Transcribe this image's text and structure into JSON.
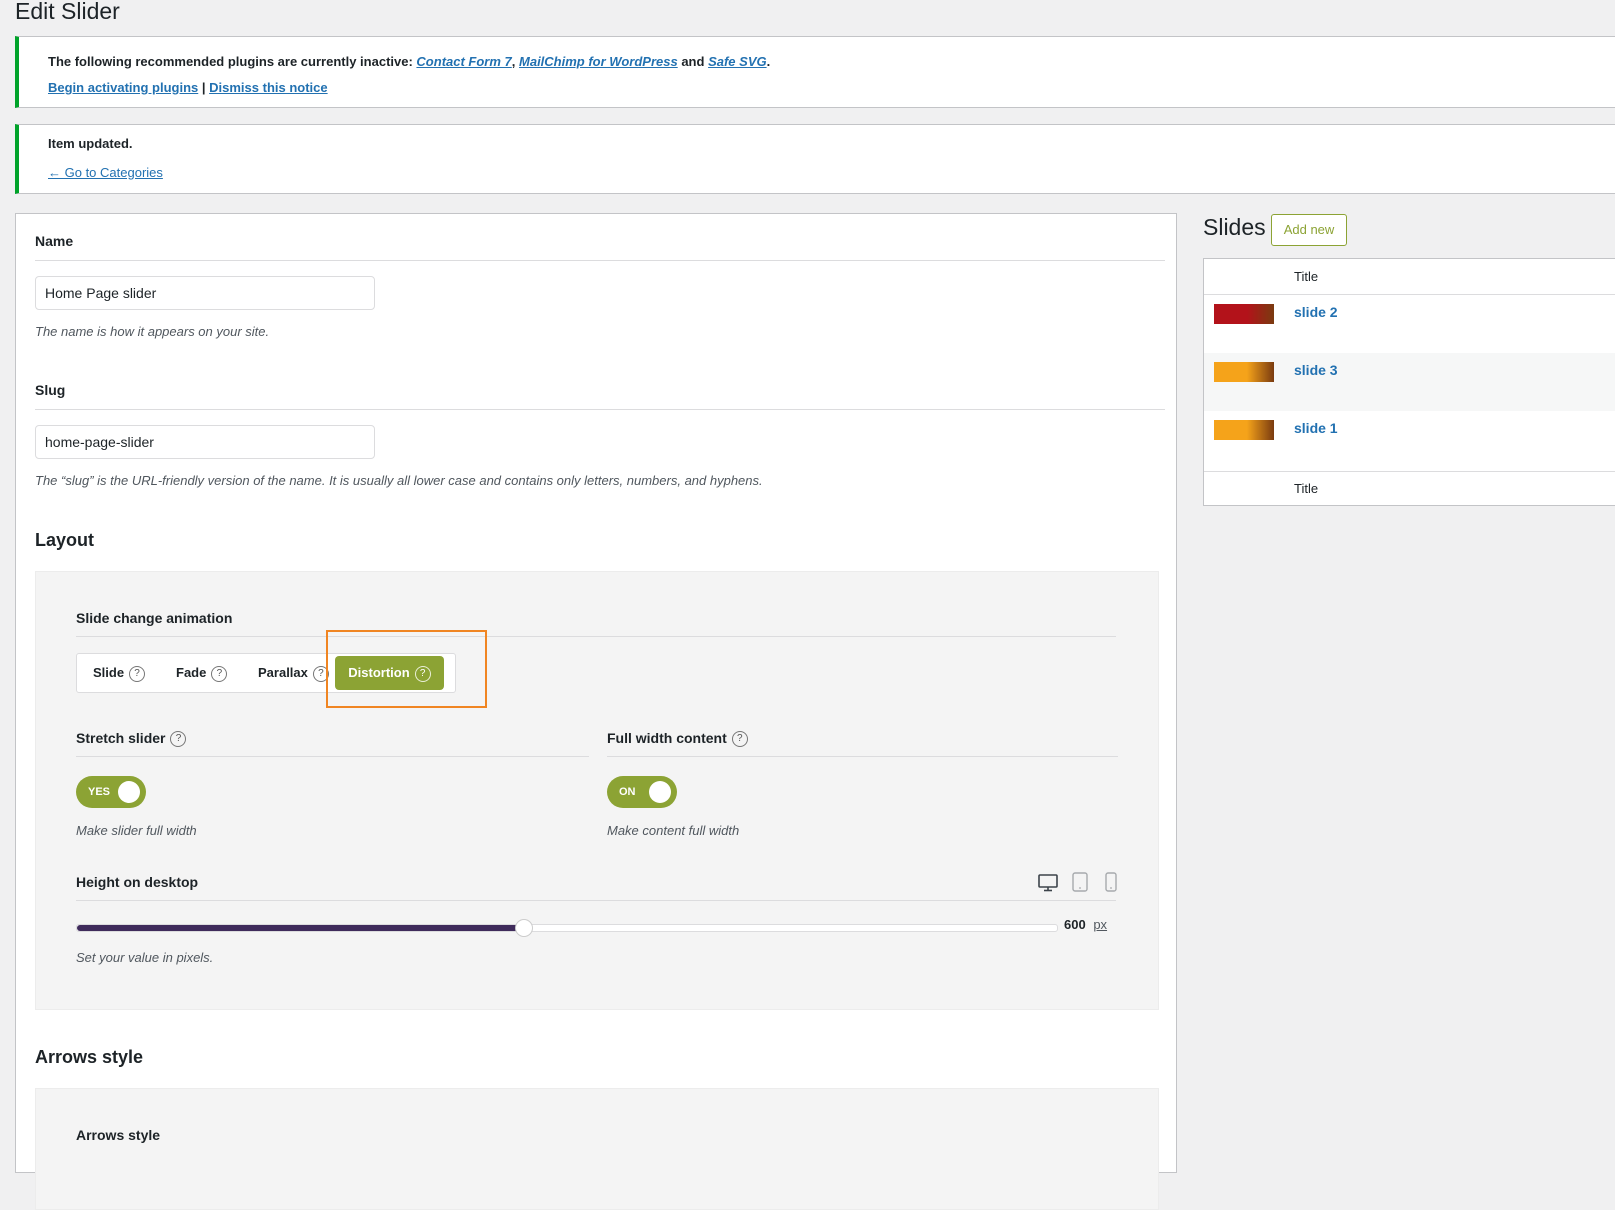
{
  "page": {
    "title": "Edit Slider"
  },
  "notice_plugins": {
    "text": "The following recommended plugins are currently inactive:",
    "plugins": [
      "Contact Form 7",
      "MailChimp for WordPress",
      "Safe SVG"
    ],
    "sep1": ",",
    "and": "and",
    "end": ".",
    "activate_link": "Begin activating plugins",
    "divider": "|",
    "dismiss_link": "Dismiss this notice"
  },
  "notice_updated": {
    "text": "Item updated.",
    "link": "← Go to Categories"
  },
  "form": {
    "name_label": "Name",
    "name_value": "Home Page slider",
    "name_desc": "The name is how it appears on your site.",
    "slug_label": "Slug",
    "slug_value": "home-page-slider",
    "slug_desc": "The “slug” is the URL-friendly version of the name. It is usually all lower case and contains only letters, numbers, and hyphens."
  },
  "layout": {
    "heading": "Layout",
    "animation_label": "Slide change animation",
    "animation_options": [
      "Slide",
      "Fade",
      "Parallax",
      "Distortion"
    ],
    "animation_selected": "Distortion",
    "help_glyph": "?",
    "stretch_label": "Stretch slider",
    "stretch_toggle": "YES",
    "stretch_desc": "Make slider full width",
    "fullwidth_label": "Full width content",
    "fullwidth_toggle": "ON",
    "fullwidth_desc": "Make content full width",
    "height_label": "Height on desktop",
    "height_value": "600",
    "height_unit": "px",
    "height_desc": "Set your value in pixels.",
    "height_fraction": 0.455,
    "devices": [
      "desktop-icon",
      "tablet-icon",
      "mobile-icon"
    ]
  },
  "arrows": {
    "heading": "Arrows style",
    "label": "Arrows style"
  },
  "slides": {
    "title": "Slides",
    "add_new": "Add new",
    "column_title": "Title",
    "items": [
      {
        "name": "slide 2",
        "thumb_color": "#b3121a"
      },
      {
        "name": "slide 3",
        "thumb_color": "#f5a31a"
      },
      {
        "name": "slide 1",
        "thumb_color": "#f5a31a"
      }
    ],
    "footer_title": "Title"
  },
  "colors": {
    "accent_green": "#8ca334",
    "notice_green": "#00a32a",
    "link_blue": "#2271b1",
    "slider_fill": "#3f2b5b",
    "highlight_orange": "#f08522"
  }
}
